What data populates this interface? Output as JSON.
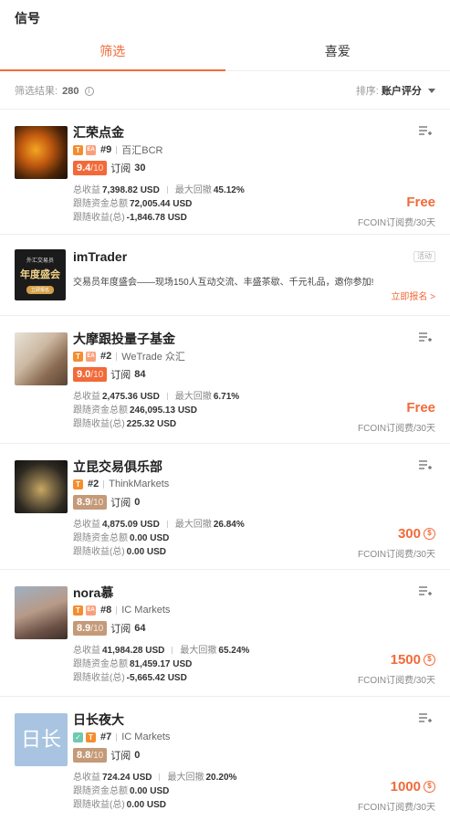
{
  "header": {
    "title": "信号"
  },
  "tabs": [
    {
      "label": "筛选",
      "active": true
    },
    {
      "label": "喜爱",
      "active": false
    }
  ],
  "filter": {
    "result_label": "筛选结果:",
    "result_count": "280",
    "sort_label": "排序:",
    "sort_value": "账户评分"
  },
  "colors": {
    "accent": "#f26a39"
  },
  "cards": [
    {
      "name": "汇荣点金",
      "rank": "#9",
      "broker": "百汇BCR",
      "score": "9.4",
      "score_den": "/10",
      "subs_label": "订阅",
      "subs": "30",
      "stat1_label": "总收益",
      "stat1_val": "7,398.82 USD",
      "stat2_label": "最大回撤",
      "stat2_val": "45.12%",
      "stat3_label": "跟随资金总额",
      "stat3_val": "72,005.44 USD",
      "stat4_label": "跟随收益(总)",
      "stat4_val": "-1,846.78 USD",
      "price": "Free",
      "price_sub": "FCOIN订阅费/30天"
    },
    {
      "name": "大摩跟投量子基金",
      "rank": "#2",
      "broker": "WeTrade 众汇",
      "score": "9.0",
      "score_den": "/10",
      "subs_label": "订阅",
      "subs": "84",
      "stat1_label": "总收益",
      "stat1_val": "2,475.36 USD",
      "stat2_label": "最大回撤",
      "stat2_val": "6.71%",
      "stat3_label": "跟随资金总额",
      "stat3_val": "246,095.13 USD",
      "stat4_label": "跟随收益(总)",
      "stat4_val": "225.32 USD",
      "price": "Free",
      "price_sub": "FCOIN订阅费/30天"
    },
    {
      "name": "立昆交易俱乐部",
      "rank": "#2",
      "broker": "ThinkMarkets",
      "score": "8.9",
      "score_den": "/10",
      "subs_label": "订阅",
      "subs": "0",
      "stat1_label": "总收益",
      "stat1_val": "4,875.09 USD",
      "stat2_label": "最大回撤",
      "stat2_val": "26.84%",
      "stat3_label": "跟随资金总额",
      "stat3_val": "0.00 USD",
      "stat4_label": "跟随收益(总)",
      "stat4_val": "0.00 USD",
      "price": "300",
      "price_sub": "FCOIN订阅费/30天"
    },
    {
      "name": "nora慕",
      "rank": "#8",
      "broker": "IC Markets",
      "score": "8.9",
      "score_den": "/10",
      "subs_label": "订阅",
      "subs": "64",
      "stat1_label": "总收益",
      "stat1_val": "41,984.28 USD",
      "stat2_label": "最大回撤",
      "stat2_val": "65.24%",
      "stat3_label": "跟随资金总额",
      "stat3_val": "81,459.17 USD",
      "stat4_label": "跟随收益(总)",
      "stat4_val": "-5,665.42 USD",
      "price": "1500",
      "price_sub": "FCOIN订阅费/30天"
    },
    {
      "name": "日长夜大",
      "rank": "#7",
      "broker": "IC Markets",
      "avatar_text": "日长",
      "score": "8.8",
      "score_den": "/10",
      "subs_label": "订阅",
      "subs": "0",
      "stat1_label": "总收益",
      "stat1_val": "724.24 USD",
      "stat2_label": "最大回撤",
      "stat2_val": "20.20%",
      "stat3_label": "跟随资金总额",
      "stat3_val": "0.00 USD",
      "stat4_label": "跟随收益(总)",
      "stat4_val": "0.00 USD",
      "price": "1000",
      "price_sub": "FCOIN订阅费/30天"
    }
  ],
  "ad": {
    "title": "imTrader",
    "tag": "活动",
    "img_line1": "外汇交易员",
    "img_line2": "年度盛会",
    "img_btn": "立即报名",
    "desc": "交易员年度盛会——现场150人互动交流、丰盛茶歇、千元礼品，邀你参加!",
    "cta": "立即报名 >"
  }
}
